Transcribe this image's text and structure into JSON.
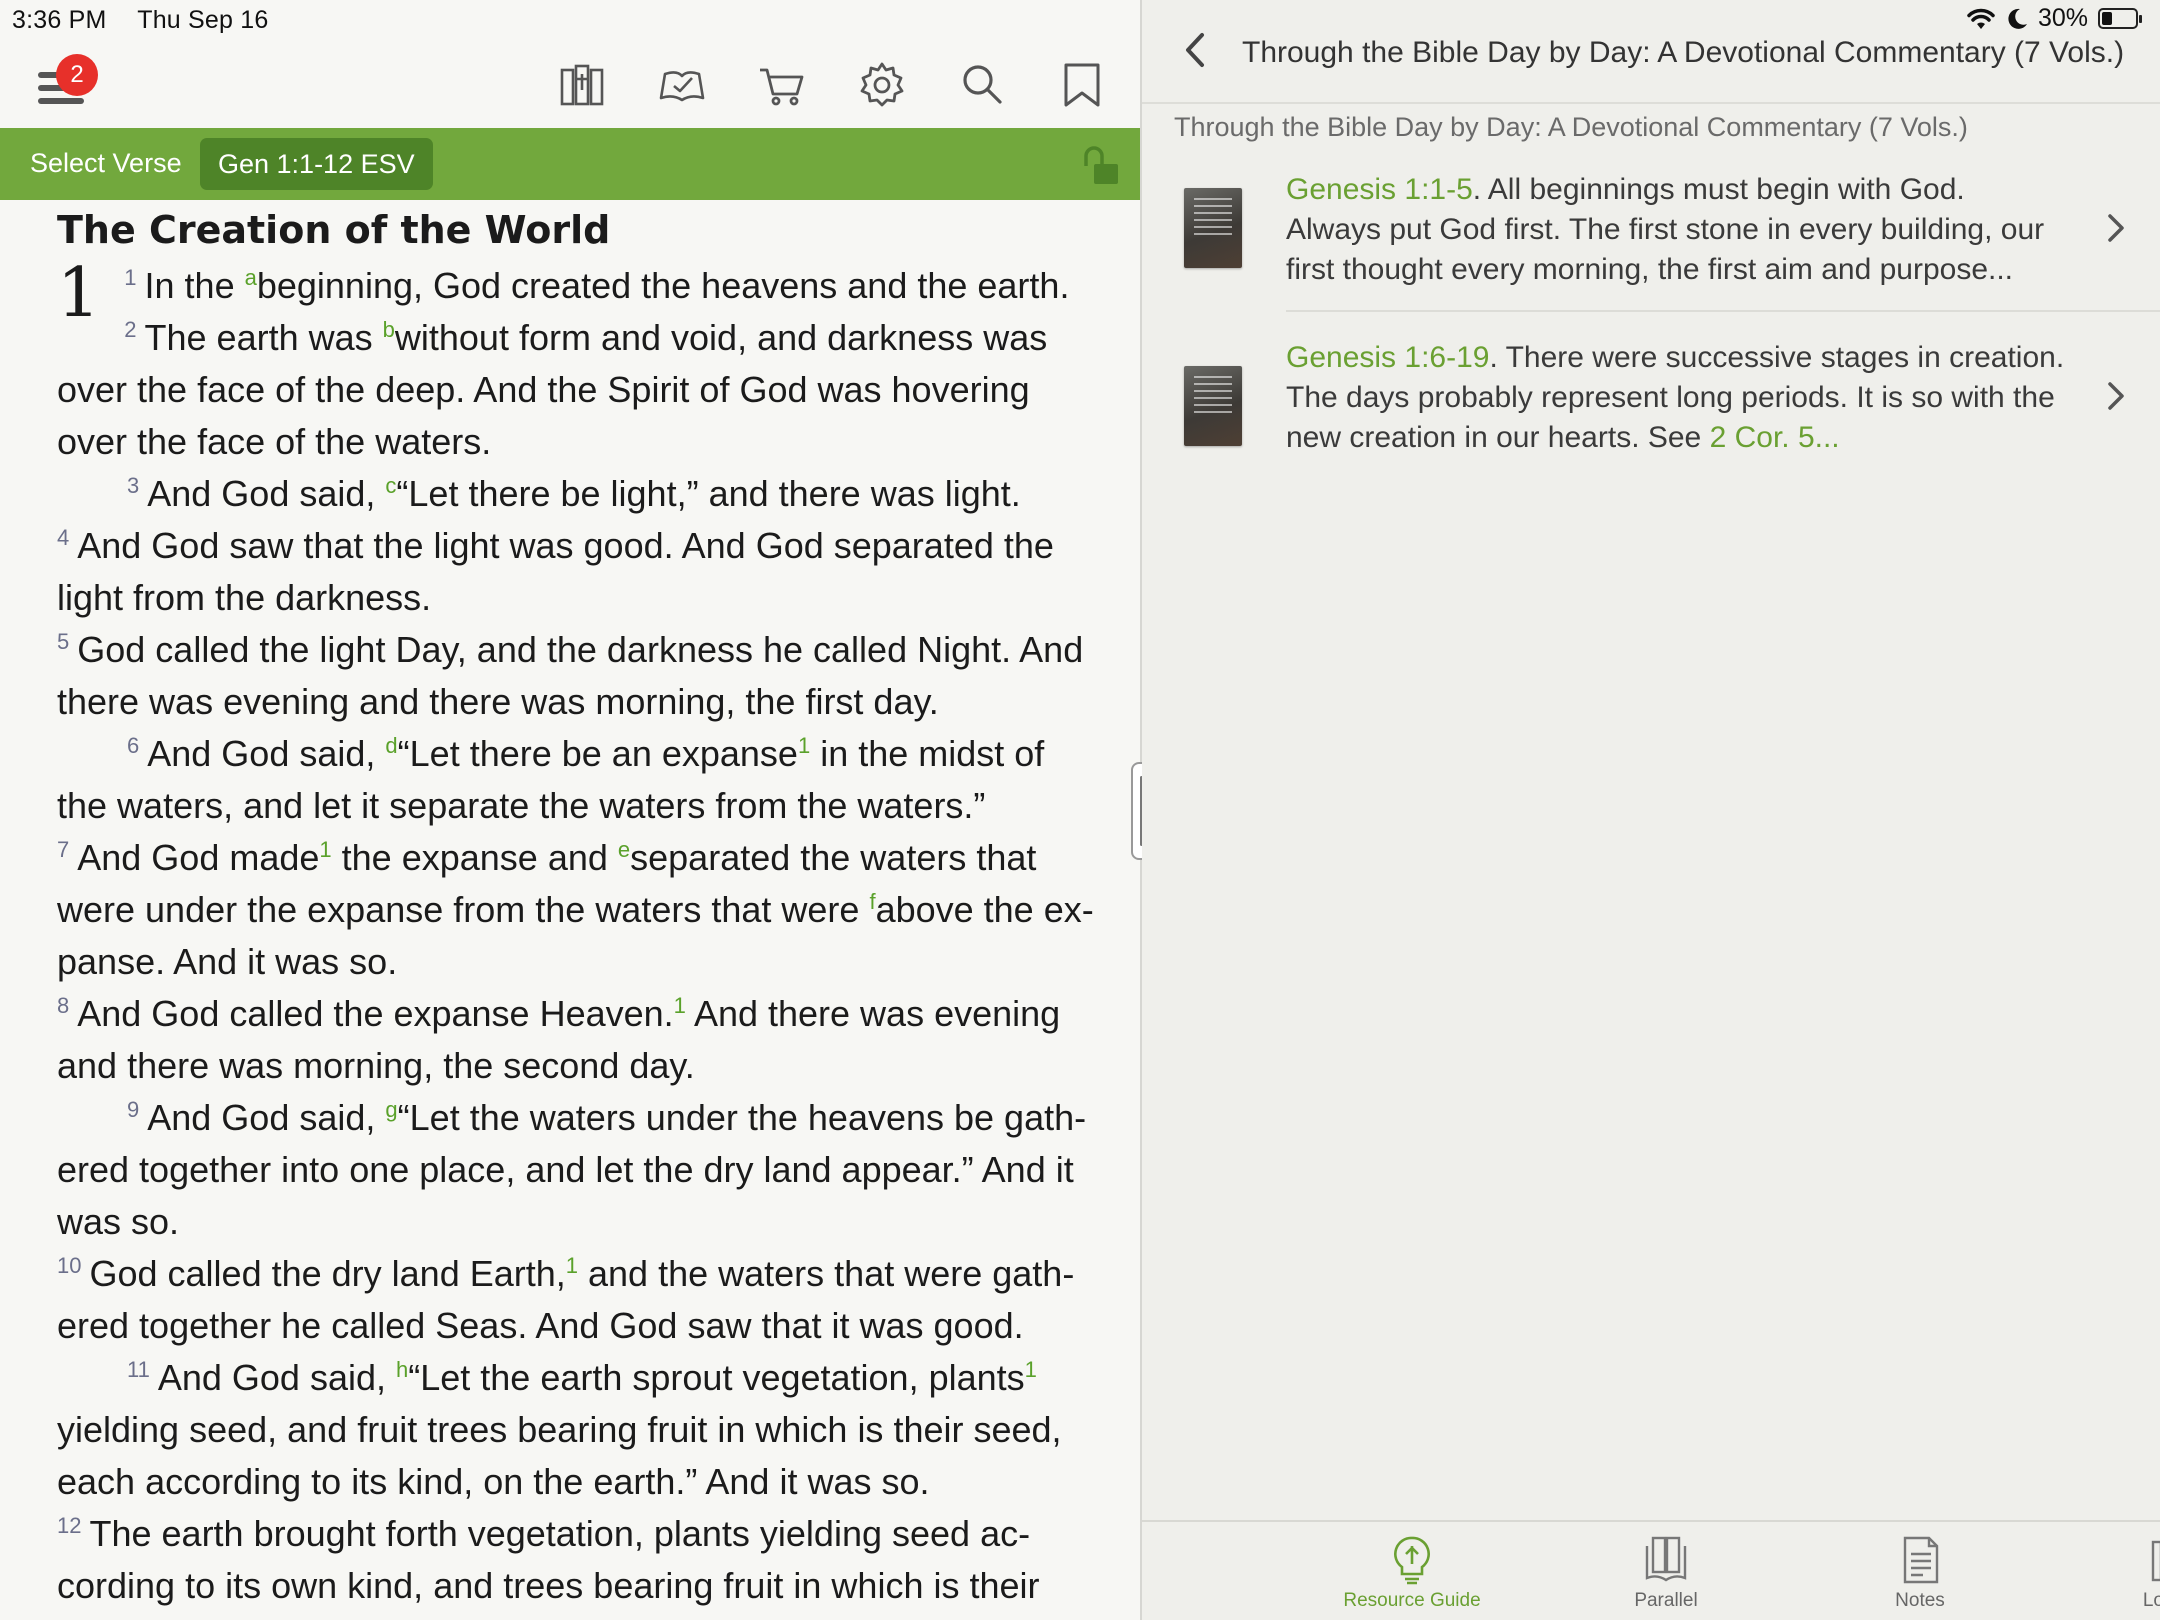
{
  "status": {
    "time": "3:36 PM",
    "date": "Thu Sep 16",
    "battery": "30%",
    "battery_level": 0.3
  },
  "toolbar": {
    "menu_badge": "2",
    "icons": [
      "library-icon",
      "reading-plan-icon",
      "cart-icon",
      "settings-icon",
      "search-icon",
      "bookmark-icon"
    ]
  },
  "reference_bar": {
    "select_verse": "Select Verse",
    "reference": "Gen 1:1-12 ESV"
  },
  "reader": {
    "heading": "The Creation of the World",
    "chapter": "1",
    "verses": [
      {
        "num": "1",
        "indent": false,
        "parts": [
          [
            "t",
            "In the "
          ],
          [
            "f",
            "a"
          ],
          [
            "t",
            "beginning, God created the heavens and the earth."
          ]
        ]
      },
      {
        "num": "2",
        "indent": false,
        "parts": [
          [
            "t",
            "The earth was "
          ],
          [
            "f",
            "b"
          ],
          [
            "t",
            "without form and void, and darkness was over the face of the deep. And the Spirit of God was hovering over the face of the waters."
          ]
        ]
      },
      {
        "num": "3",
        "indent": true,
        "parts": [
          [
            "t",
            "And God said, "
          ],
          [
            "f",
            "c"
          ],
          [
            "t",
            "“Let there be light,” and there was light."
          ]
        ]
      },
      {
        "num": "4",
        "indent": false,
        "parts": [
          [
            "t",
            "And God saw that the light was good. And God separated the light from the darkness."
          ]
        ]
      },
      {
        "num": "5",
        "indent": false,
        "parts": [
          [
            "t",
            "God called the light Day, and the darkness he called Night. And there was evening and there was morning, the first day."
          ]
        ]
      },
      {
        "num": "6",
        "indent": true,
        "parts": [
          [
            "t",
            "And God said, "
          ],
          [
            "f",
            "d"
          ],
          [
            "t",
            "“Let there be an expanse"
          ],
          [
            "f",
            "1"
          ],
          [
            "t",
            " in the midst of the waters, and let it separate the waters from the waters.”"
          ]
        ]
      },
      {
        "num": "7",
        "indent": false,
        "parts": [
          [
            "t",
            "And God made"
          ],
          [
            "f",
            "1"
          ],
          [
            "t",
            " the expanse and "
          ],
          [
            "f",
            "e"
          ],
          [
            "t",
            "separated the waters that were under the expanse from the waters that were "
          ],
          [
            "f",
            "f"
          ],
          [
            "t",
            "above the ex­panse. And it was so."
          ]
        ]
      },
      {
        "num": "8",
        "indent": false,
        "parts": [
          [
            "t",
            "And God called the expanse Heaven."
          ],
          [
            "f",
            "1"
          ],
          [
            "t",
            " And there was evening and there was morning, the second day."
          ]
        ]
      },
      {
        "num": "9",
        "indent": true,
        "parts": [
          [
            "t",
            "And God said, "
          ],
          [
            "f",
            "g"
          ],
          [
            "t",
            "“Let the waters under the heavens be gath­ered together into one place, and let the dry land appear.” And it was so."
          ]
        ]
      },
      {
        "num": "10",
        "indent": false,
        "parts": [
          [
            "t",
            "God called the dry land Earth,"
          ],
          [
            "f",
            "1"
          ],
          [
            "t",
            " and the waters that were gath­ered together he called Seas. And God saw that it was good."
          ]
        ]
      },
      {
        "num": "11",
        "indent": true,
        "parts": [
          [
            "t",
            "And God said, "
          ],
          [
            "f",
            "h"
          ],
          [
            "t",
            "“Let the earth sprout vegetation, plants"
          ],
          [
            "f",
            "1"
          ],
          [
            "t",
            " yielding seed, and fruit trees bearing fruit in which is their seed, each according to its kind, on the earth.” And it was so."
          ]
        ]
      },
      {
        "num": "12",
        "indent": false,
        "parts": [
          [
            "t",
            "The earth brought forth vegetation, plants yielding seed ac­cording to its own kind, and trees bearing fruit in which is their seed, each according to its kind. And God saw that it was good."
          ]
        ]
      }
    ]
  },
  "right_panel": {
    "nav_title": "Through the Bible Day by Day: A Devotional Commentary (7 Vols.)",
    "section_title": "Through the Bible Day by Day: A Devotional Commentary (7 Vols.)",
    "results": [
      {
        "ref": "Genesis 1:1-5",
        "text": ". All beginnings must begin with God. Always put God first. The first stone in every building, our first thought every morning, the first aim and purpose...",
        "link": ""
      },
      {
        "ref": "Genesis 1:6-19",
        "text": ". There were successive stages in creation. The days probably represent long periods. It is so with the new creation in our hearts. See ",
        "link": "2 Cor. 5..."
      }
    ]
  },
  "tabs": [
    {
      "label": "Resource Guide",
      "icon": "lightbulb-icon",
      "active": true
    },
    {
      "label": "Parallel",
      "icon": "parallel-books-icon",
      "active": false
    },
    {
      "label": "Notes",
      "icon": "notes-icon",
      "active": false
    },
    {
      "label": "Lookup",
      "icon": "lookup-icon",
      "active": false
    }
  ],
  "colors": {
    "accent_green": "#72a83d",
    "ref_button": "#4e8428",
    "link_green": "#6aa032",
    "badge_red": "#e7302a"
  }
}
